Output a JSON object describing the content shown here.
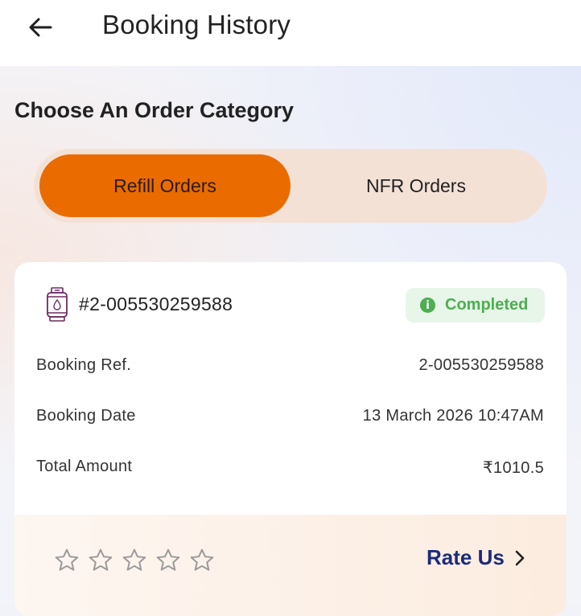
{
  "header": {
    "title": "Booking History",
    "back_icon": "arrow-left-icon"
  },
  "category": {
    "heading": "Choose An Order Category",
    "tabs": [
      {
        "label": "Refill Orders",
        "active": true
      },
      {
        "label": "NFR Orders",
        "active": false
      }
    ],
    "active_color": "#ea6b00",
    "track_color": "#f4e1d6"
  },
  "order": {
    "icon": "gas-cylinder-icon",
    "id": "#2-005530259588",
    "status": "Completed",
    "status_icon": "info-icon",
    "status_color": "#4caf50",
    "details": [
      {
        "label": "Booking Ref.",
        "value": "2-005530259588"
      },
      {
        "label": "Booking Date",
        "value": "13 March 2026 10:47AM"
      },
      {
        "label": "Total Amount",
        "value": "₹1010.5"
      }
    ],
    "rating": {
      "stars_total": 5,
      "stars_filled": 0,
      "action_label": "Rate Us",
      "action_color": "#1c2b7a"
    }
  }
}
